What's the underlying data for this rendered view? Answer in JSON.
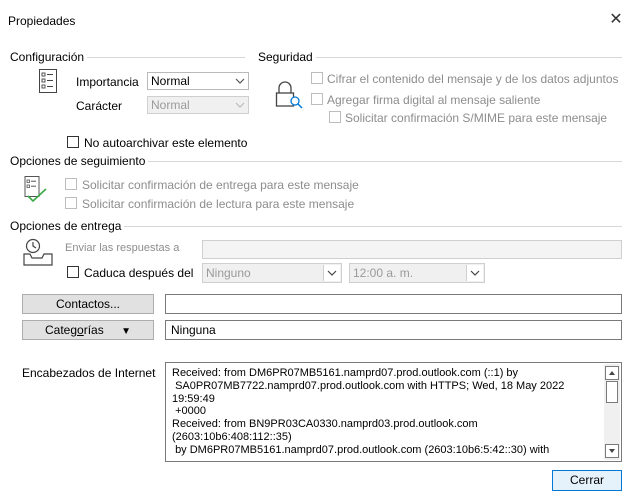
{
  "window": {
    "title": "Propiedades",
    "close_glyph": "✕"
  },
  "configuracion": {
    "heading": "Configuración",
    "importancia": {
      "label": "Importancia",
      "value": "Normal"
    },
    "caracter": {
      "label": "Carácter",
      "value": "Normal"
    },
    "no_autoarchivar": {
      "label": "No autoarchivar este elemento",
      "checked": false
    }
  },
  "seguridad": {
    "heading": "Seguridad",
    "cifrar": {
      "label": "Cifrar el contenido del mensaje y de los datos adjuntos",
      "checked": false,
      "enabled": false
    },
    "firma": {
      "label": "Agregar firma digital al mensaje saliente",
      "checked": false,
      "enabled": false
    },
    "smime": {
      "label": "Solicitar confirmación S/MIME para este mensaje",
      "checked": false,
      "enabled": false
    },
    "icon": "lock-icon"
  },
  "seguimiento": {
    "heading": "Opciones de seguimiento",
    "entrega": {
      "label": "Solicitar confirmación de entrega para este mensaje",
      "checked": false,
      "enabled": false
    },
    "lectura": {
      "label": "Solicitar confirmación de lectura para este mensaje",
      "checked": false,
      "enabled": false
    },
    "icon": "tracking-checklist-icon"
  },
  "entrega": {
    "heading": "Opciones de entrega",
    "enviar_respuestas": {
      "label": "Enviar las respuestas a",
      "value": ""
    },
    "caduca": {
      "label": "Caduca después del",
      "checked": false,
      "date": "Ninguno",
      "time": "12:00 a. m."
    },
    "icon": "delivery-clock-icon"
  },
  "contactos": {
    "button": "Contactos...",
    "value": ""
  },
  "categorias": {
    "button_pre": "Categ",
    "button_u": "o",
    "button_post": "rías",
    "arrow": "▼",
    "value": "Ninguna"
  },
  "internet_headers": {
    "label": "Encabezados de Internet",
    "text": "Received: from DM6PR07MB5161.namprd07.prod.outlook.com (::1) by\n SA0PR07MB7722.namprd07.prod.outlook.com with HTTPS; Wed, 18 May 2022\n19:59:49\n +0000\nReceived: from BN9PR03CA0330.namprd03.prod.outlook.com\n(2603:10b6:408:112::35)\n by DM6PR07MB5161.namprd07.prod.outlook.com (2603:10b6:5:42::30) with"
  },
  "footer": {
    "close_button": "Cerrar"
  },
  "colors": {
    "accent": "#0078d7",
    "icon_green": "#3aa845",
    "disabled_text": "#8d8d8d"
  }
}
